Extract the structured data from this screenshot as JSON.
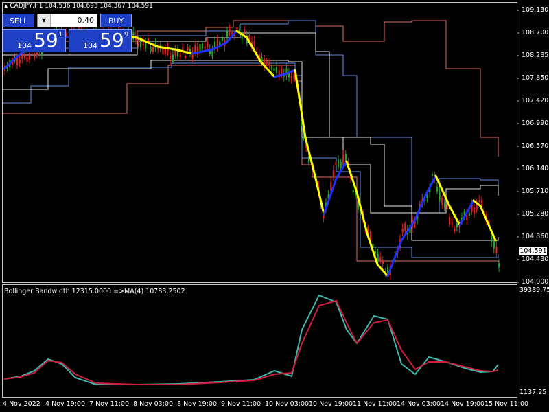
{
  "chart": {
    "symbol_title": "CADJPY,H1  104.536 104.693 104.367 104.591",
    "current_price_tag": "104.591",
    "colors": {
      "bull": "#2ca02c",
      "bear": "#e02020",
      "channel_white": "#e6e6e6",
      "channel_blue": "#5f8fe6",
      "channel_salmon": "#e07060",
      "ma_yellow": "#ffff00",
      "ma_blue": "#2030ff",
      "bw_cyan": "#40b8b0",
      "bw_red": "#d02040"
    }
  },
  "one_click": {
    "sell_label": "SELL",
    "buy_label": "BUY",
    "volume": "0.40",
    "bid_big": "104",
    "bid_main": "59",
    "bid_sup": "1",
    "ask_big": "104",
    "ask_main": "59",
    "ask_sup": "9"
  },
  "price_axis": [
    "109.130",
    "108.700",
    "108.285",
    "107.850",
    "107.420",
    "106.990",
    "106.570",
    "106.140",
    "105.710",
    "105.280",
    "104.860",
    "104.430",
    "104.000"
  ],
  "indicator": {
    "title": "Bollinger Bandwidth 12315.0000  =>MA(4) 10783.2502",
    "axis_top": "39389.75",
    "axis_bottom": "1137.25"
  },
  "time_axis": [
    "4 Nov 2022",
    "4 Nov 19:00",
    "7 Nov 11:00",
    "8 Nov 03:00",
    "8 Nov 19:00",
    "9 Nov 11:00",
    "10 Nov 03:00",
    "10 Nov 19:00",
    "11 Nov 11:00",
    "14 Nov 03:00",
    "14 Nov 19:00",
    "15 Nov 11:00"
  ]
}
